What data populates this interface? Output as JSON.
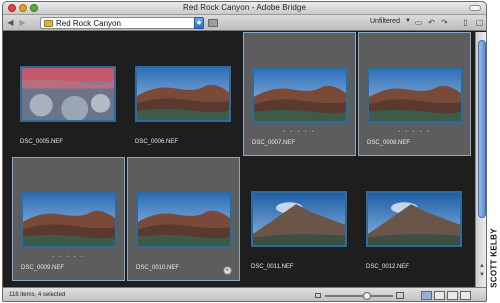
{
  "window": {
    "title": "Red Rock Canyon - Adobe Bridge"
  },
  "toolbar": {
    "path": "Red Rock Canyon",
    "filter": "Unfiltered"
  },
  "thumbnails": [
    {
      "filename": "DSC_0005.NEF",
      "selected": false,
      "rating": "",
      "scene": "brush"
    },
    {
      "filename": "DSC_0006.NEF",
      "selected": false,
      "rating": "",
      "scene": "canyon"
    },
    {
      "filename": "DSC_0007.NEF",
      "selected": true,
      "rating": "• • • • •",
      "scene": "canyon"
    },
    {
      "filename": "DSC_0008.NEF",
      "selected": true,
      "rating": "• • • • •",
      "scene": "canyon"
    },
    {
      "filename": "DSC_0009.NEF",
      "selected": true,
      "rating": "• • • • •",
      "scene": "canyon"
    },
    {
      "filename": "DSC_0010.NEF",
      "selected": true,
      "rating": "",
      "scene": "canyon",
      "badge": true
    },
    {
      "filename": "DSC_0011.NEF",
      "selected": false,
      "rating": "",
      "scene": "peak"
    },
    {
      "filename": "DSC_0012.NEF",
      "selected": false,
      "rating": "",
      "scene": "peak"
    }
  ],
  "status": {
    "text": "118 items, 4 selected"
  },
  "watermark": "SCOTT KELBY",
  "colors": {
    "selection": "#5d5d5d",
    "background": "#1e1e1e",
    "accent": "#2e6a9a"
  }
}
